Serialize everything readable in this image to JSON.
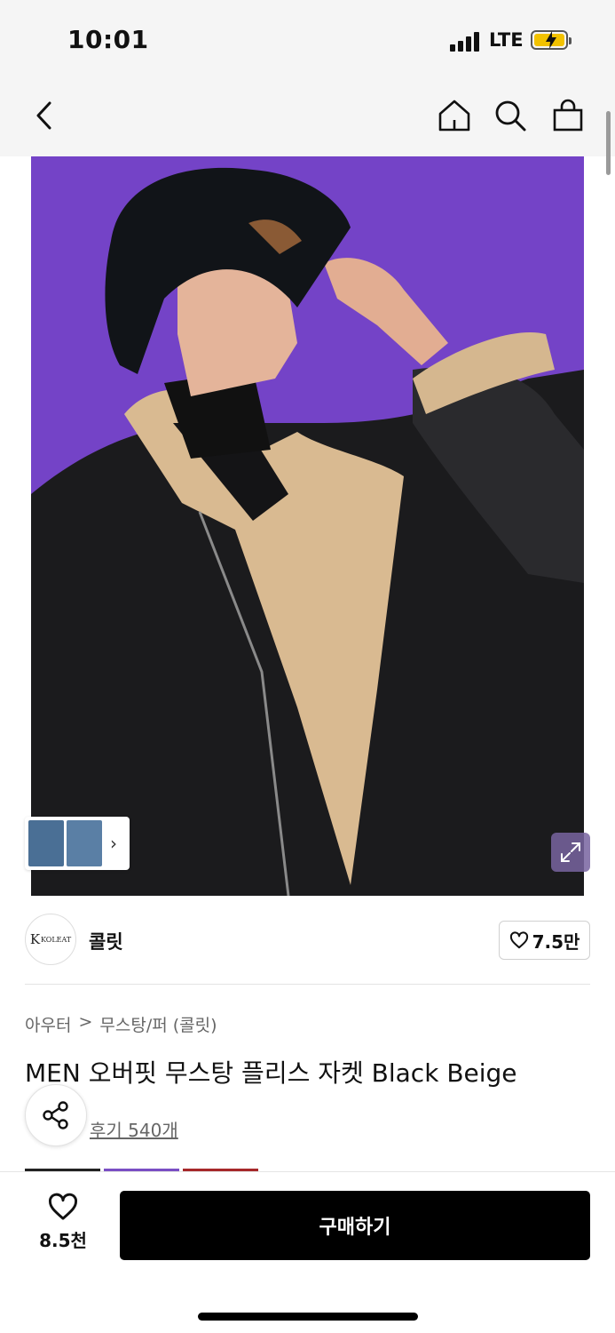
{
  "status_bar": {
    "time": "10:01",
    "network": "LTE"
  },
  "nav": {
    "back_icon": "chevron-left-icon",
    "home_icon": "home-icon",
    "search_icon": "search-icon",
    "cart_icon": "shopping-bag-icon"
  },
  "hero": {
    "background_color": "#7443c7",
    "thumbnail_more_icon": "chevron-right-icon",
    "expand_icon": "expand-icon"
  },
  "brand": {
    "logo_text": "KOLEAT",
    "name": "콜릿",
    "like_count": "7.5만"
  },
  "breadcrumb": {
    "category": "아우터",
    "separator": ">",
    "subcategory": "무스탕/퍼 (콜릿)"
  },
  "product": {
    "title": "MEN 오버핏 무스탕 플리스 자켓 Black Beige",
    "review_link": "후기 540개"
  },
  "swatch_colors": [
    "#222222",
    "#7a4fc4",
    "#a6282a"
  ],
  "bottom_bar": {
    "wish_count": "8.5천",
    "buy_label": "구매하기"
  }
}
